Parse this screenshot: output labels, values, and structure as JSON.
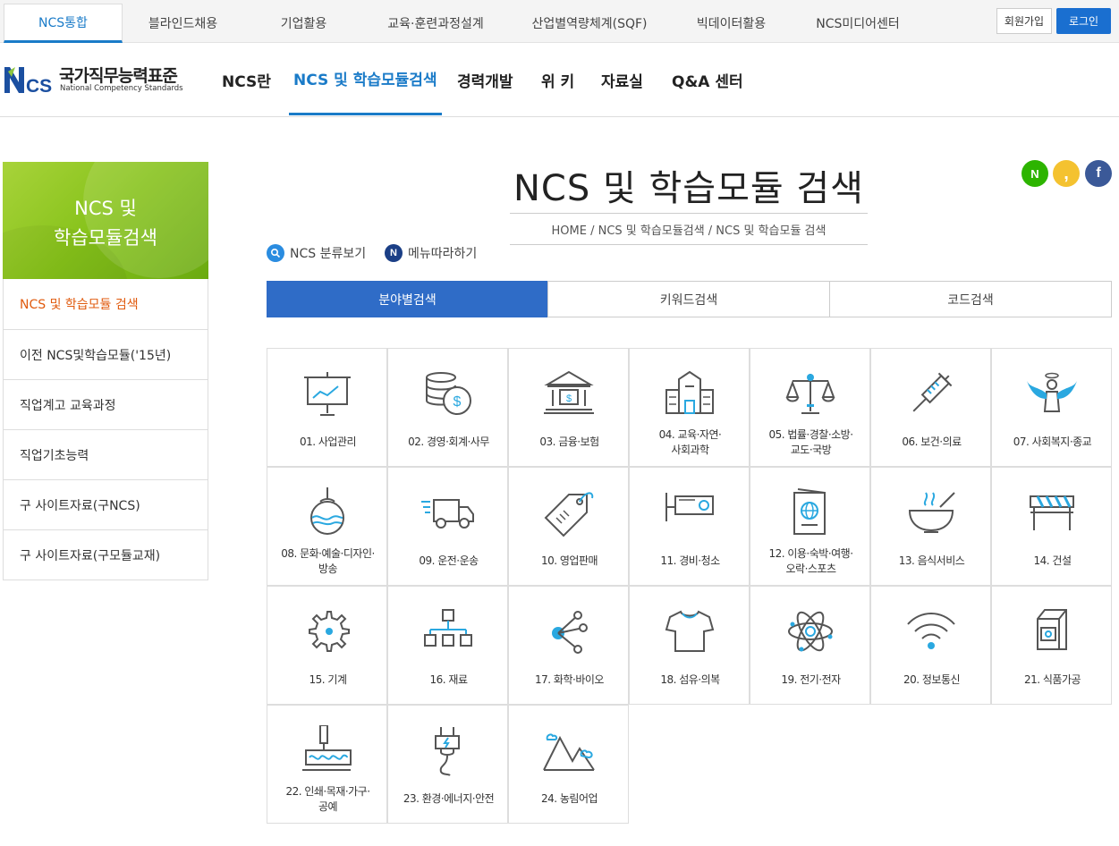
{
  "top_tabs": [
    "NCS통합",
    "블라인드채용",
    "기업활용",
    "교육·훈련과정설계",
    "산업별역량체계(SQF)",
    "빅데이터활용",
    "NCS미디어센터"
  ],
  "account": {
    "join": "회원가입",
    "login": "로그인"
  },
  "logo": {
    "mark": "NCS",
    "ko": "국가직무능력표준",
    "en": "National Competency Standards"
  },
  "main_nav": [
    "NCS란",
    "NCS 및 학습모듈검색",
    "경력개발",
    "위 키",
    "자료실",
    "Q&A 센터"
  ],
  "sidebar": {
    "title": "NCS 및\n학습모듈검색",
    "items": [
      "NCS 및 학습모듈 검색",
      "이전 NCS및학습모듈('15년)",
      "직업계고 교육과정",
      "직업기초능력",
      "구 사이트자료(구NCS)",
      "구 사이트자료(구모듈교재)"
    ]
  },
  "page": {
    "title": "NCS 및 학습모듈 검색",
    "breadcrumb": "HOME / NCS 및 학습모듈검색 / NCS 및 학습모듈 검색"
  },
  "sns": [
    {
      "name": "naver",
      "glyph": "N",
      "color": "#2db400"
    },
    {
      "name": "kakao",
      "glyph": ",",
      "color": "#f4c230"
    },
    {
      "name": "facebook",
      "glyph": "f",
      "color": "#3b5998"
    }
  ],
  "tools": {
    "classify": "NCS 분류보기",
    "menu_follow": "메뉴따라하기"
  },
  "search_tabs": [
    "분야별검색",
    "키워드검색",
    "코드검색"
  ],
  "categories": [
    {
      "label": "01. 사업관리",
      "icon": "presentation-board-icon"
    },
    {
      "label": "02. 경영·회계·사무",
      "icon": "coins-dollar-icon"
    },
    {
      "label": "03. 금융·보험",
      "icon": "bank-icon"
    },
    {
      "label": "04. 교육·자연·\n사회과학",
      "icon": "school-building-icon"
    },
    {
      "label": "05. 법률·경찰·소방·\n교도·국방",
      "icon": "scales-icon"
    },
    {
      "label": "06. 보건·의료",
      "icon": "syringe-icon"
    },
    {
      "label": "07. 사회복지·종교",
      "icon": "angel-icon"
    },
    {
      "label": "08. 문화·예술·디자인·\n방송",
      "icon": "ornament-icon"
    },
    {
      "label": "09. 운전·운송",
      "icon": "truck-icon"
    },
    {
      "label": "10. 영업판매",
      "icon": "price-tag-icon"
    },
    {
      "label": "11. 경비·청소",
      "icon": "cctv-icon"
    },
    {
      "label": "12. 이용·숙박·여행·\n오락·스포츠",
      "icon": "passport-icon"
    },
    {
      "label": "13. 음식서비스",
      "icon": "bowl-icon"
    },
    {
      "label": "14. 건설",
      "icon": "construction-barrier-icon"
    },
    {
      "label": "15. 기계",
      "icon": "gear-icon"
    },
    {
      "label": "16. 재료",
      "icon": "hierarchy-blocks-icon"
    },
    {
      "label": "17. 화학·바이오",
      "icon": "molecule-icon"
    },
    {
      "label": "18. 섬유·의복",
      "icon": "tshirt-icon"
    },
    {
      "label": "19. 전기·전자",
      "icon": "atom-icon"
    },
    {
      "label": "20. 정보통신",
      "icon": "wifi-icon"
    },
    {
      "label": "21. 식품가공",
      "icon": "milk-carton-icon"
    },
    {
      "label": "22. 인쇄·목재·가구·\n공예",
      "icon": "paint-roller-icon"
    },
    {
      "label": "23. 환경·에너지·안전",
      "icon": "power-plug-icon"
    },
    {
      "label": "24. 농림어업",
      "icon": "mountains-icon"
    }
  ],
  "colors": {
    "accent": "#1a7bc8",
    "active_tab": "#2f6cc7",
    "sidebar_active": "#e05a0e",
    "banner": "#86c21a",
    "icon_accent": "#2aa8e0"
  }
}
